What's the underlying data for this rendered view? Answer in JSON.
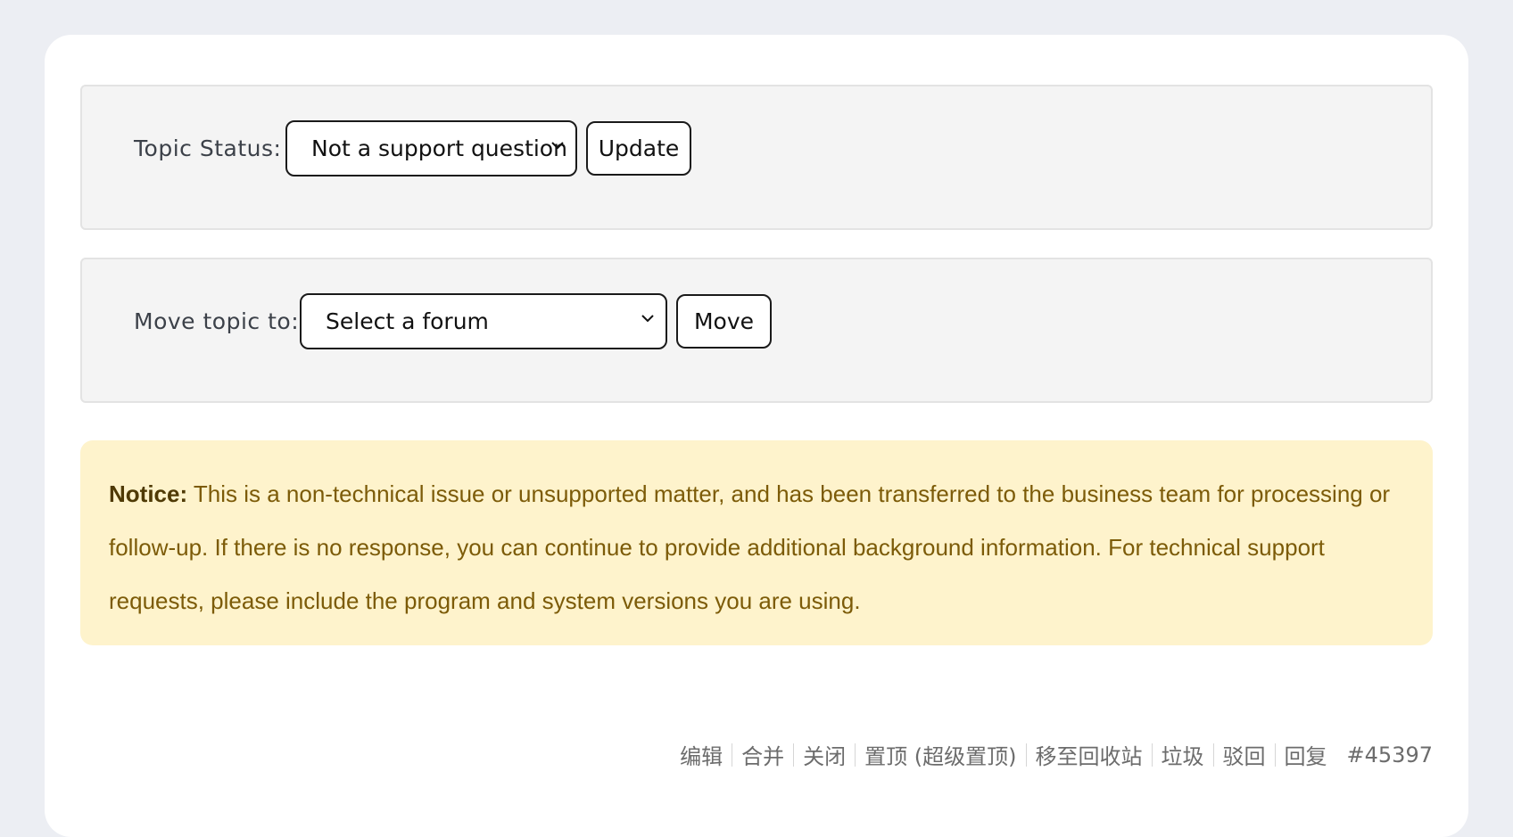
{
  "topic_status": {
    "label": "Topic Status:",
    "selected": "Not a support question",
    "button": "Update"
  },
  "move_topic": {
    "label": "Move topic to:",
    "selected": "Select a forum",
    "button": "Move"
  },
  "notice": {
    "prefix": "Notice:",
    "text": "This is a non-technical issue or unsupported matter, and has been transferred to the business team for processing or follow-up. If there is no response, you can continue to provide additional background information. For technical support requests, please include the program and system versions you are using."
  },
  "admin_links": [
    "编辑",
    "合并",
    "关闭",
    "置顶 (超级置顶)",
    "移至回收站",
    "垃圾",
    "驳回",
    "回复"
  ],
  "post_id": "#45397",
  "colors": {
    "background": "#eceef3",
    "card": "#ffffff",
    "panel": "#f4f4f4",
    "notice_bg": "#fef3cc",
    "notice_text": "#7c5b08"
  },
  "icons": {
    "dropdown": "chevron-down-icon"
  }
}
